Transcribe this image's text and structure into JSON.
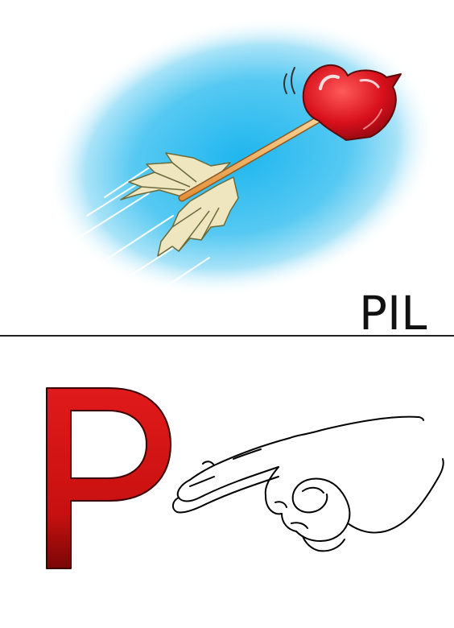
{
  "card": {
    "word": "PIL",
    "letter": "P"
  },
  "colors": {
    "sky_glow": "#29c0f2",
    "heart_red": "#d8101c",
    "letter_red": "#d21414",
    "shaft": "#f3b25a",
    "feather": "#efe6c0"
  },
  "icons": {
    "picture": "arrow-with-heart-icon",
    "sign": "hand-sign-p-icon"
  }
}
